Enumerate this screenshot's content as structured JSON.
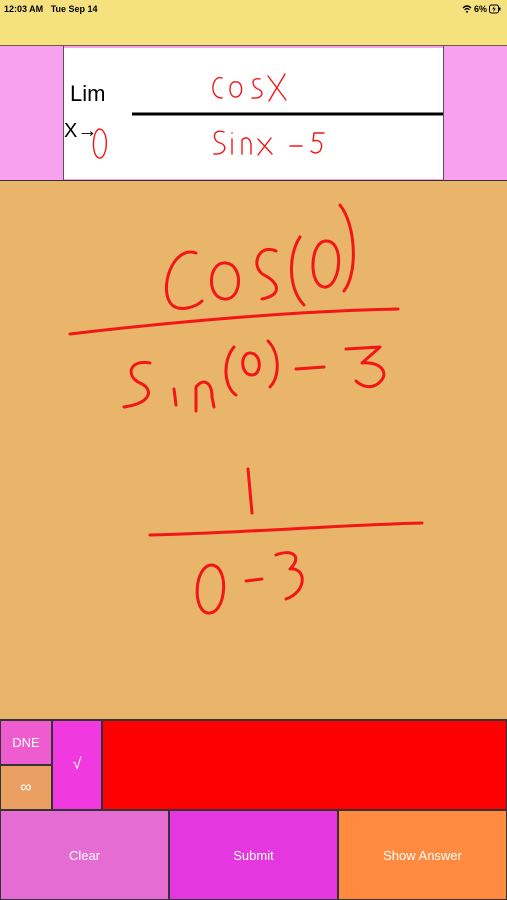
{
  "status_bar": {
    "time": "12:03 AM",
    "date": "Tue Sep 14",
    "battery": "6%"
  },
  "problem": {
    "lim_label": "Lim",
    "approach_label": "X→"
  },
  "answer_buttons": {
    "dne_label": "DNE",
    "infinity_label": "∞",
    "sqrt_label": "√"
  },
  "actions": {
    "clear_label": "Clear",
    "submit_label": "Submit",
    "show_answer_label": "Show Answer"
  },
  "colors": {
    "status_bar": "#F5E27F",
    "pink_panel": "#F8A1F0",
    "canvas": "#E9B56B",
    "ink": "#F21616",
    "answer_field": "#FF0000",
    "dne": "#EE5CD0",
    "infinity": "#E9A062",
    "sqrt": "#F03AE0",
    "clear": "#E56CD3",
    "submit": "#E437DF",
    "show_answer": "#FF8A40"
  }
}
